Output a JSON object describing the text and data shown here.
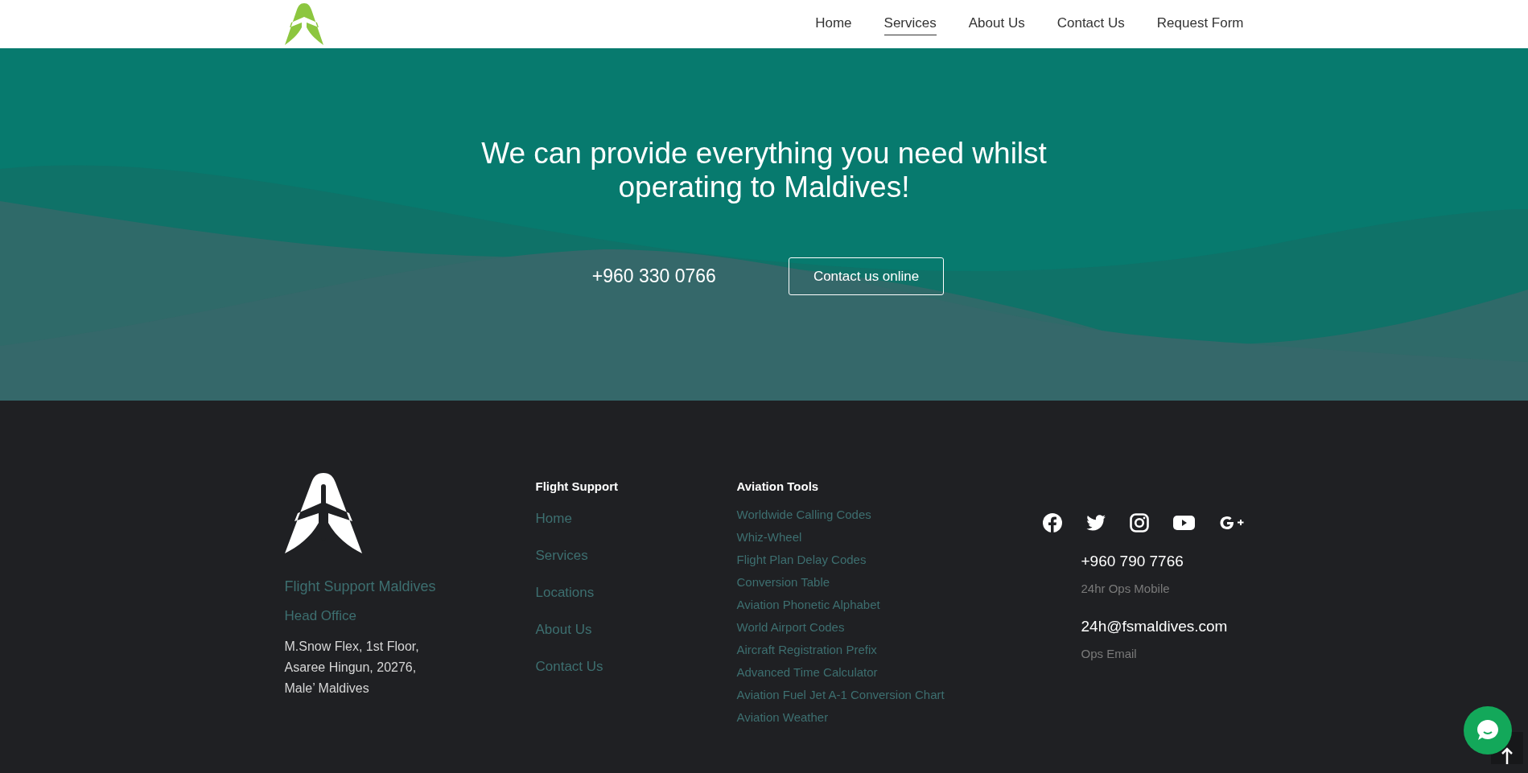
{
  "nav": [
    {
      "label": "Home",
      "selected": false
    },
    {
      "label": "Services",
      "selected": true
    },
    {
      "label": "About Us",
      "selected": false
    },
    {
      "label": "Contact Us",
      "selected": false
    },
    {
      "label": "Request Form",
      "selected": false
    }
  ],
  "hero": {
    "title": "We can provide everything you need whilst operating to Maldives!",
    "phone": "+960 330 0766",
    "button": "Contact us online"
  },
  "footer": {
    "company": "Flight Support Maldives",
    "office": "Head Office",
    "address": [
      "M.Snow Flex, 1st Floor,",
      "Asaree Hingun, 20276,",
      "Male’ Maldives"
    ],
    "flight_support": {
      "heading": "Flight Support",
      "links": [
        "Home",
        "Services",
        "Locations",
        "About Us",
        "Contact Us"
      ]
    },
    "aviation_tools": {
      "heading": "Aviation Tools",
      "links": [
        "Worldwide Calling Codes",
        "Whiz-Wheel",
        "Flight Plan Delay Codes",
        "Conversion Table",
        "Aviation Phonetic Alphabet",
        "World Airport Codes",
        "Aircraft Registration Prefix",
        "Advanced Time Calculator",
        "Aviation Fuel Jet A-1 Conversion Chart",
        "Aviation Weather"
      ]
    },
    "social": [
      {
        "kind": "facebook"
      },
      {
        "kind": "twitter"
      },
      {
        "kind": "instagram"
      },
      {
        "kind": "youtube"
      },
      {
        "kind": "googleplus"
      }
    ],
    "contacts": [
      {
        "value": "+960 790 7766",
        "label": "24hr Ops Mobile"
      },
      {
        "value": "24h@fsmaldives.com",
        "label": "Ops Email"
      }
    ]
  }
}
